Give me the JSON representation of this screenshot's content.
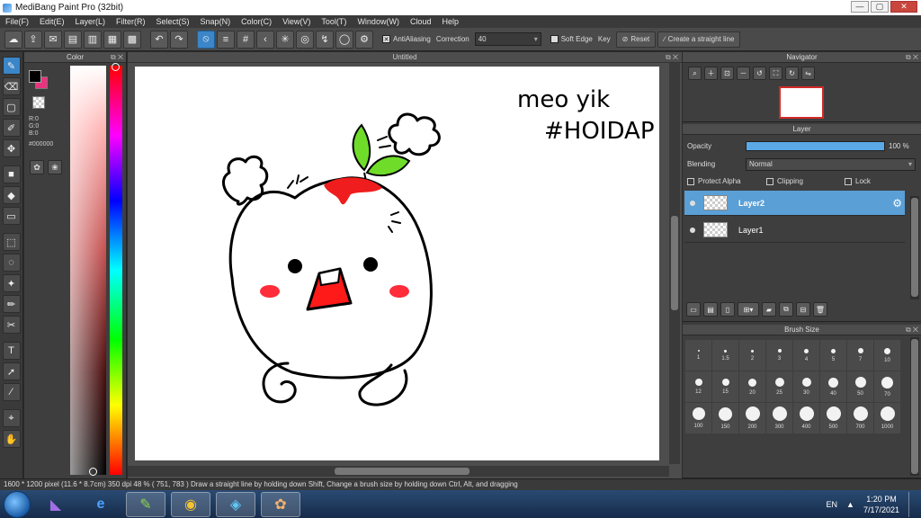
{
  "window": {
    "title": "MediBang Paint Pro (32bit)",
    "min": "—",
    "max": "▢",
    "close": "✕"
  },
  "menu": [
    "File(F)",
    "Edit(E)",
    "Layer(L)",
    "Filter(R)",
    "Select(S)",
    "Snap(N)",
    "Color(C)",
    "View(V)",
    "Tool(T)",
    "Window(W)",
    "Cloud",
    "Help"
  ],
  "toolbar": {
    "antialiasing_label": "AntiAliasing",
    "correction_label": "Correction",
    "correction_value": "40",
    "soft_edge_label": "Soft Edge",
    "key_label": "Key",
    "reset_label": "Reset",
    "straight_line_label": "Create a straight line"
  },
  "color_panel": {
    "title": "Color",
    "r": "R:0",
    "g": "G:0",
    "b": "B:0",
    "hex": "#000000",
    "fg_color": "#000000",
    "bg_color": "#e8347f"
  },
  "canvas": {
    "tab_title": "Untitled",
    "handwriting_line1": "meo yik",
    "handwriting_line2": "#HOIDAP"
  },
  "navigator": {
    "title": "Navigator"
  },
  "layer_panel": {
    "title": "Layer",
    "opacity_label": "Opacity",
    "opacity_value": "100 %",
    "opacity_percent": 100,
    "blending_label": "Blending",
    "blending_value": "Normal",
    "protect_alpha": "Protect Alpha",
    "clipping": "Clipping",
    "lock": "Lock",
    "layers": [
      {
        "name": "Layer2",
        "selected": true
      },
      {
        "name": "Layer1",
        "selected": false
      }
    ]
  },
  "brush_size": {
    "title": "Brush Size",
    "sizes": [
      "1",
      "1.5",
      "2",
      "3",
      "4",
      "5",
      "7",
      "10",
      "12",
      "15",
      "20",
      "25",
      "30",
      "40",
      "50",
      "70",
      "100",
      "150",
      "200",
      "300",
      "400",
      "500",
      "700",
      "1000"
    ]
  },
  "status": {
    "text": "1600 * 1200 pixel  (11.6 * 8.7cm)  350 dpi  48 %  ( 751, 783 )  Draw a straight line by holding down Shift, Change a brush size by holding down Ctrl, Alt, and dragging"
  },
  "taskbar": {
    "lang": "EN",
    "time": "1:20 PM",
    "date": "7/17/2021"
  }
}
